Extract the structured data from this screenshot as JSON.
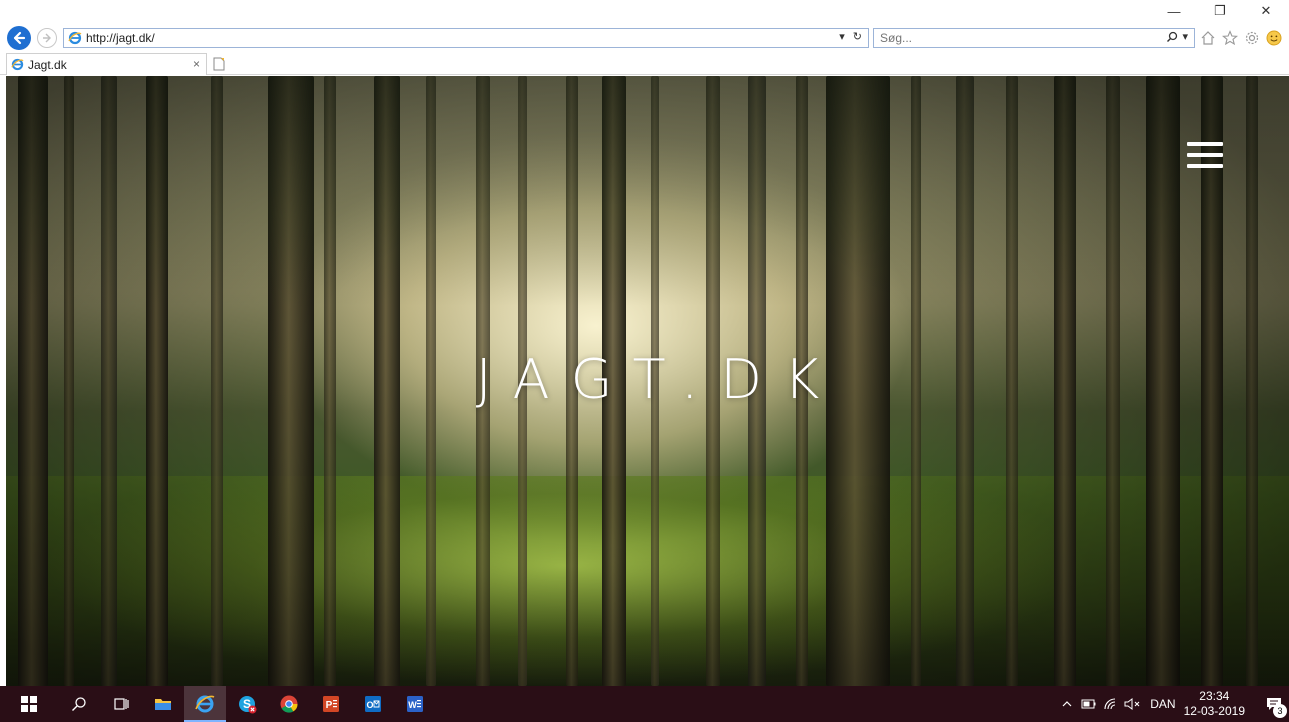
{
  "browser": {
    "url": "http://jagt.dk/",
    "search_placeholder": "Søg...",
    "tab_title": "Jagt.dk",
    "accent_color": "#1f6fd1"
  },
  "window_controls": {
    "minimize": "—",
    "restore": "❐",
    "close": "✕"
  },
  "page": {
    "site_title": "JAGT.DK",
    "menu_icon": "hamburger-menu-icon",
    "title_color": "#ffffff"
  },
  "taskbar": {
    "apps": [
      "start",
      "search",
      "task-view",
      "file-explorer",
      "internet-explorer",
      "skype",
      "chrome",
      "powerpoint",
      "outlook",
      "word"
    ],
    "active_app": "internet-explorer",
    "language": "DAN",
    "time": "23:34",
    "date": "12-03-2019",
    "notification_count": "3",
    "background_color": "#2a0e16"
  }
}
